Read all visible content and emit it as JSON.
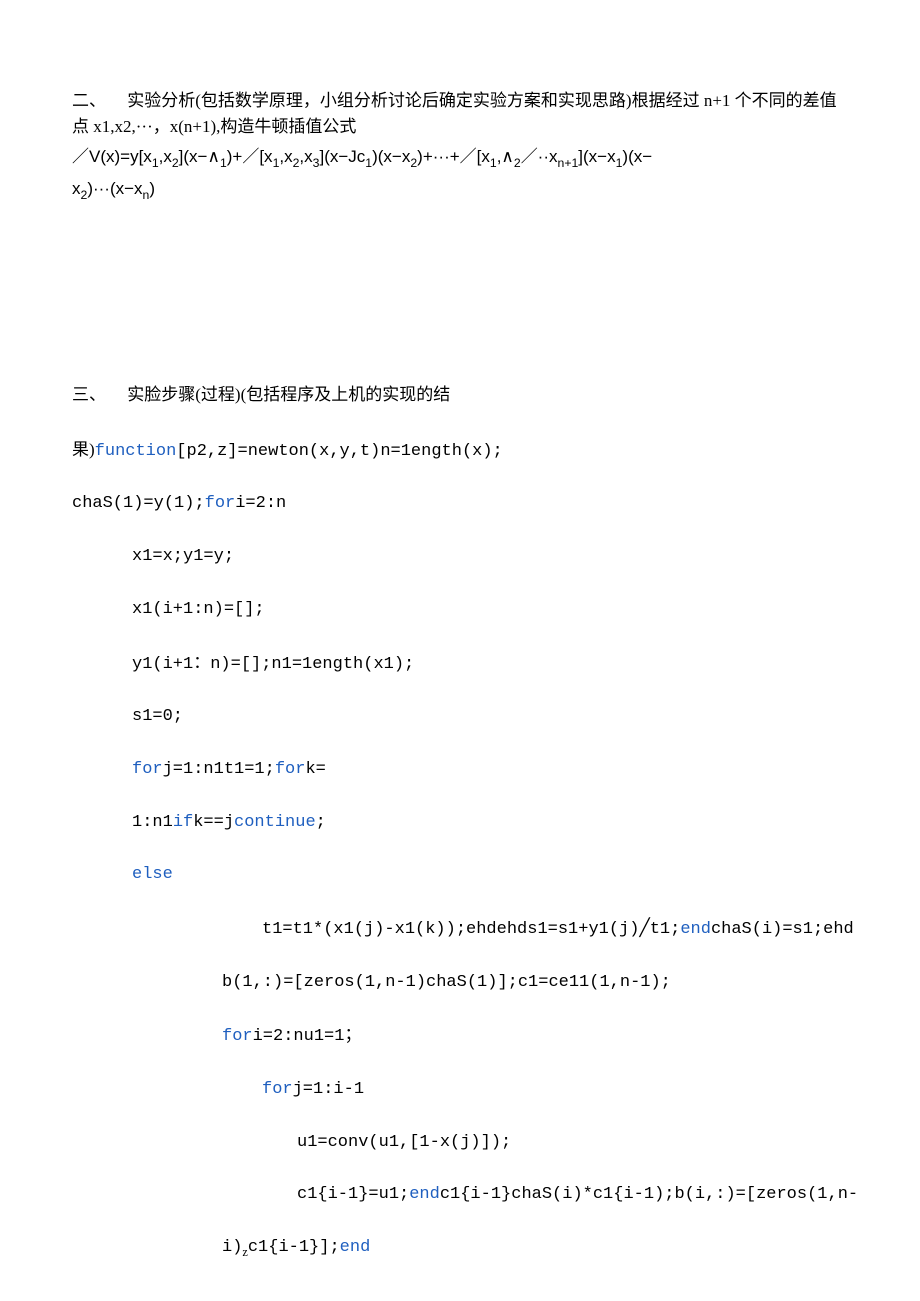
{
  "section2": {
    "heading_prefix": "二、",
    "heading_body": "实验分析(包括数学原理，小组分析讨论后确定实验方案和实现思路)根据经过 n+1 个不同的差值点 x1,x2,···，x(n+1),构造牛顿插值公式",
    "formula_line1_pre": "／V(x)=y[x",
    "formula_line1_s1": "1",
    "formula_line1_a": ",x",
    "formula_line1_s2": "2",
    "formula_line1_b": "](x−∧",
    "formula_line1_s3": "1",
    "formula_line1_c": ")+／[x",
    "formula_line1_s4": "1",
    "formula_line1_d": ",x",
    "formula_line1_s5": "2",
    "formula_line1_e": ",x",
    "formula_line1_s6": "3",
    "formula_line1_f": "](x−Jc",
    "formula_line1_s7": "1",
    "formula_line1_g": ")(x−x",
    "formula_line1_s8": "2",
    "formula_line1_h": ")+···+／[x",
    "formula_line1_s9": "1",
    "formula_line1_i": ",∧",
    "formula_line1_s10": "2",
    "formula_line1_j": "／··x",
    "formula_line1_s11": "n+1",
    "formula_line1_k": "](x−x",
    "formula_line1_s12": "1",
    "formula_line1_l": ")(x−",
    "formula_line2_pre": "x",
    "formula_line2_s1": "2",
    "formula_line2_a": ")···(x−x",
    "formula_line2_s2": "n",
    "formula_line2_b": ")"
  },
  "section3": {
    "heading_prefix": "三、",
    "heading_body": "实脸步骤(过程)(包括程序及上机的实现的结",
    "line2_han": "果)",
    "kw_function": "function",
    "line2_code": "[p2,z]=newton(x,y,t)n=1ength(x);",
    "line3_a": "chaS(1)=y(1);",
    "kw_for": "for",
    "line3_b": "i=2:n",
    "line4": "x1=x;y1=y;",
    "line5": "x1(i+1:n)=[];",
    "line6": "y1(i+1:n)=[];n1=1ength(x1);",
    "somicolon_han1": "：",
    "line7": "s1=0;",
    "line8_a": "j=1:n1t1=1;",
    "line8_b": "k=",
    "kw_if": "if",
    "line9_a": "1:n1",
    "line9_b": "k==j",
    "kw_continue": "continue",
    "line9_c": ";",
    "kw_else": "else",
    "line11_a": "t1=t1*(x1(j)-x1(k));ehdehds1=s1+y1(j)",
    "line11_slash": "╱",
    "line11_b": "t1;",
    "kw_end": "end",
    "line11_c": "chaS(i)=s1;ehd",
    "line12": "b(1,:)=[zeros(1,n-1)chaS(1)];c1=ce11(1,n-1);",
    "line13_a": "i=2:nu1=1",
    "semicolon_han2": "；",
    "line14": "j=1:i-1",
    "line15": "u1=conv(u1,[1-x(j)]);",
    "line16_a": "c1{i-1}=u1;",
    "line16_b": "c1{i-1}chaS(i)*c1{i-1);b(i,:)=[zeros(1,n-",
    "line17_a": "i)",
    "line17_sub": "z",
    "line17_b": "c1{i-1}];"
  }
}
